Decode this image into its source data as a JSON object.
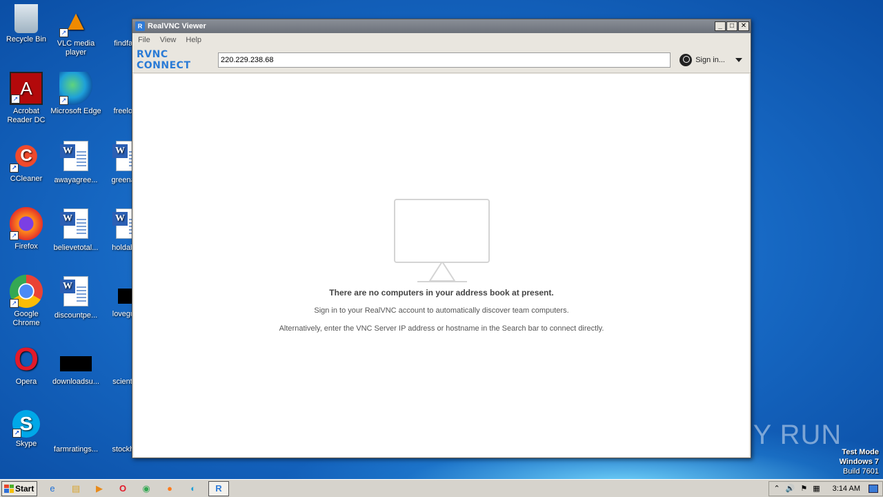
{
  "desktop": {
    "icons": [
      {
        "label": "Recycle Bin",
        "glyph": "🗑"
      },
      {
        "label": "VLC media player",
        "glyph": "▲"
      },
      {
        "label": "findfax..."
      },
      {
        "label": "Acrobat Reader DC",
        "glyph": "A"
      },
      {
        "label": "Microsoft Edge",
        "glyph": "e"
      },
      {
        "label": "freeloa..."
      },
      {
        "label": "CCleaner",
        "glyph": "C"
      },
      {
        "label": "awayagree..."
      },
      {
        "label": "greenac..."
      },
      {
        "label": "Firefox",
        "glyph": "🦊"
      },
      {
        "label": "believetotal..."
      },
      {
        "label": "holdabs..."
      },
      {
        "label": "Google Chrome",
        "glyph": "◉"
      },
      {
        "label": "discountpe..."
      },
      {
        "label": "loveguil..."
      },
      {
        "label": "Opera",
        "glyph": "O"
      },
      {
        "label": "downloadsu..."
      },
      {
        "label": "scientifi..."
      },
      {
        "label": "Skype",
        "glyph": "S"
      },
      {
        "label": "farmratings..."
      },
      {
        "label": "stockho..."
      }
    ]
  },
  "window": {
    "title": "RealVNC Viewer",
    "app_icon": "R",
    "controls": {
      "minimize": "_",
      "maximize": "□",
      "close": "✕"
    },
    "menu": [
      "File",
      "View",
      "Help"
    ],
    "brand": "RVNC CONNECT",
    "address_value": "220.229.238.68",
    "signin_label": "Sign in...",
    "empty_title": "There are no computers in your address book at present.",
    "empty_line1": "Sign in to your RealVNC account to automatically discover team computers.",
    "empty_line2": "Alternatively, enter the VNC Server IP address or hostname in the Search bar to connect directly."
  },
  "taskbar": {
    "start_label": "Start",
    "time": "3:14 AM"
  },
  "overlay": {
    "watermark": "ANY RUN",
    "test_mode": "Test Mode",
    "os": "Windows 7",
    "build": "Build 7601"
  },
  "colors": {
    "brand": "#2a7bd6",
    "desktop": "#1667c2"
  }
}
